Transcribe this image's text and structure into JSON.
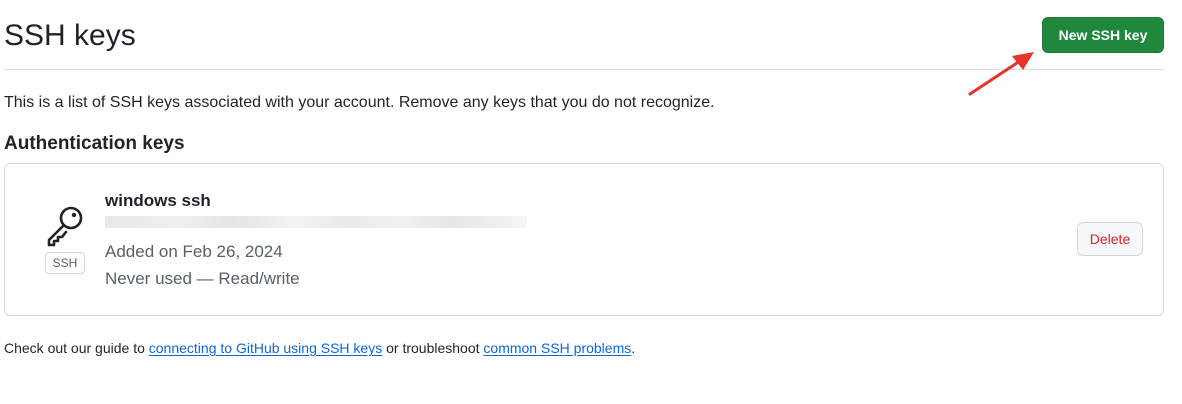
{
  "header": {
    "title": "SSH keys",
    "new_key_label": "New SSH key"
  },
  "intro_text": "This is a list of SSH keys associated with your account. Remove any keys that you do not recognize.",
  "section_title": "Authentication keys",
  "keys": [
    {
      "title": "windows ssh",
      "type_badge": "SSH",
      "added": "Added on Feb 26, 2024",
      "usage": "Never used — Read/write",
      "delete_label": "Delete",
      "icon": "key-icon"
    }
  ],
  "footer": {
    "prefix": "Check out our guide to ",
    "link1": "connecting to GitHub using SSH keys",
    "middle": " or troubleshoot ",
    "link2": "common SSH problems",
    "suffix": "."
  },
  "colors": {
    "primary_button": "#1f883d",
    "danger_text": "#cf222e",
    "link": "#0969da",
    "annotation_arrow": "#e8332a"
  }
}
